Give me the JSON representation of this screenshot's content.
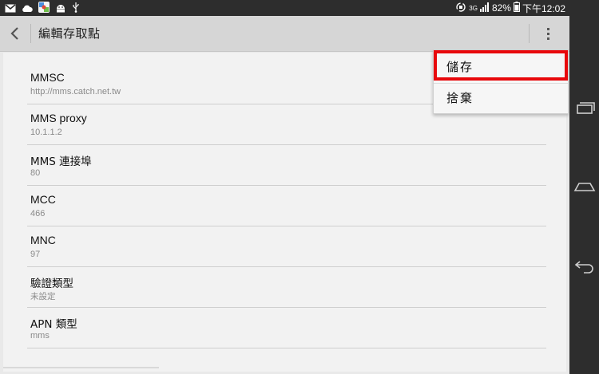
{
  "status_bar": {
    "battery": "82%",
    "time": "下午12:02",
    "network": "3G"
  },
  "action_bar": {
    "title": "編輯存取點"
  },
  "fields": [
    {
      "title": "MMSC",
      "value": "http://mms.catch.net.tw"
    },
    {
      "title": "MMS proxy",
      "value": "10.1.1.2"
    },
    {
      "title": "MMS 連接埠",
      "value": "80"
    },
    {
      "title": "MCC",
      "value": "466"
    },
    {
      "title": "MNC",
      "value": "97"
    },
    {
      "title": "驗證類型",
      "value": "未設定"
    },
    {
      "title": "APN 類型",
      "value": "mms"
    }
  ],
  "menu": {
    "save": "儲存",
    "discard": "捨棄"
  },
  "colors": {
    "highlight": "#e8070b",
    "status_bar": "#2d2d2d",
    "action_bar": "#d6d6d6"
  }
}
